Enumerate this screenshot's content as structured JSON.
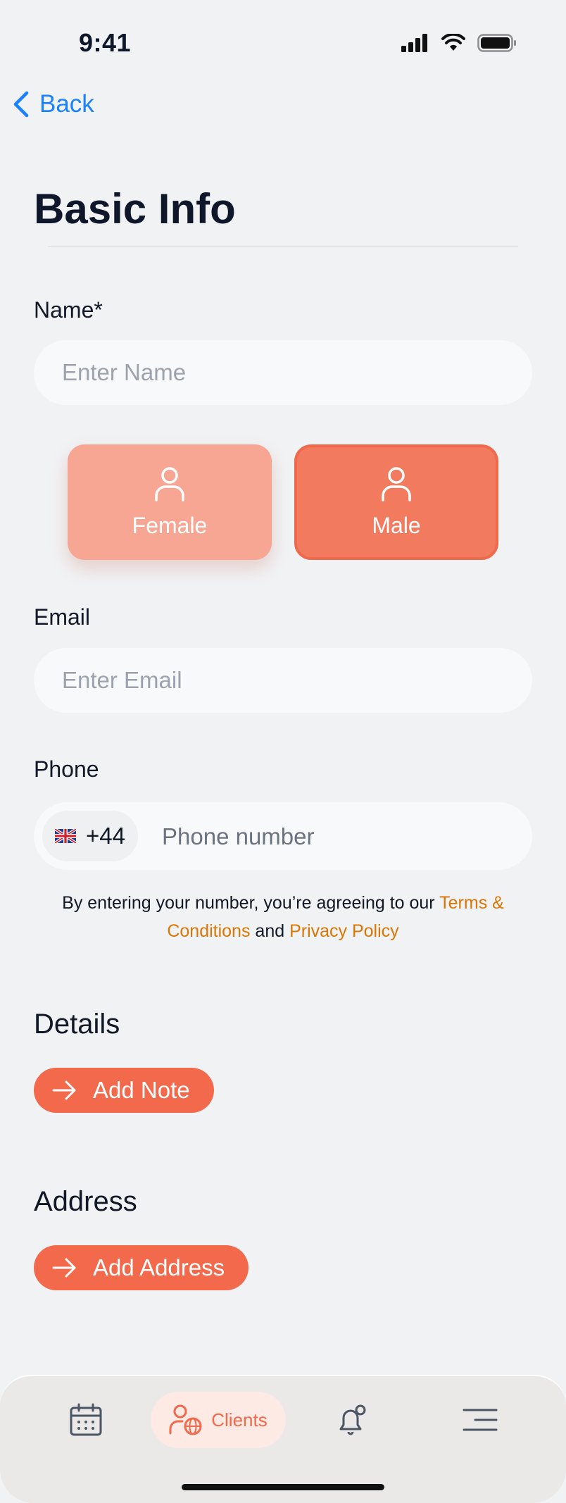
{
  "status_bar": {
    "time": "9:41"
  },
  "nav": {
    "back_label": "Back"
  },
  "page": {
    "title": "Basic Info"
  },
  "form": {
    "name": {
      "label": "Name*",
      "placeholder": "Enter Name",
      "value": ""
    },
    "gender": {
      "options": [
        "Female",
        "Male"
      ],
      "selected": "Male"
    },
    "email": {
      "label": "Email",
      "placeholder": "Enter Email",
      "value": ""
    },
    "phone": {
      "label": "Phone",
      "country_code": "+44",
      "placeholder": "Phone number",
      "value": ""
    },
    "terms": {
      "prefix": "By entering your number, you’re agreeing to our ",
      "terms_link": "Terms & Conditions",
      "conjunction": " and ",
      "privacy_link": "Privacy Policy"
    }
  },
  "details": {
    "heading": "Details",
    "button_label": "Add Note"
  },
  "address": {
    "heading": "Address",
    "button_label": "Add Address"
  },
  "tabbar": {
    "tabs": [
      {
        "icon": "calendar-icon",
        "label": ""
      },
      {
        "icon": "clients-globe-icon",
        "label": "Clients",
        "active": true
      },
      {
        "icon": "notification-bell-icon",
        "label": ""
      },
      {
        "icon": "menu-icon",
        "label": ""
      }
    ]
  },
  "colors": {
    "accent": "#f2694c",
    "link": "#1a82ff",
    "terms_link": "#d97706",
    "female_bg": "#f7a694",
    "male_bg": "#f27a5e"
  }
}
